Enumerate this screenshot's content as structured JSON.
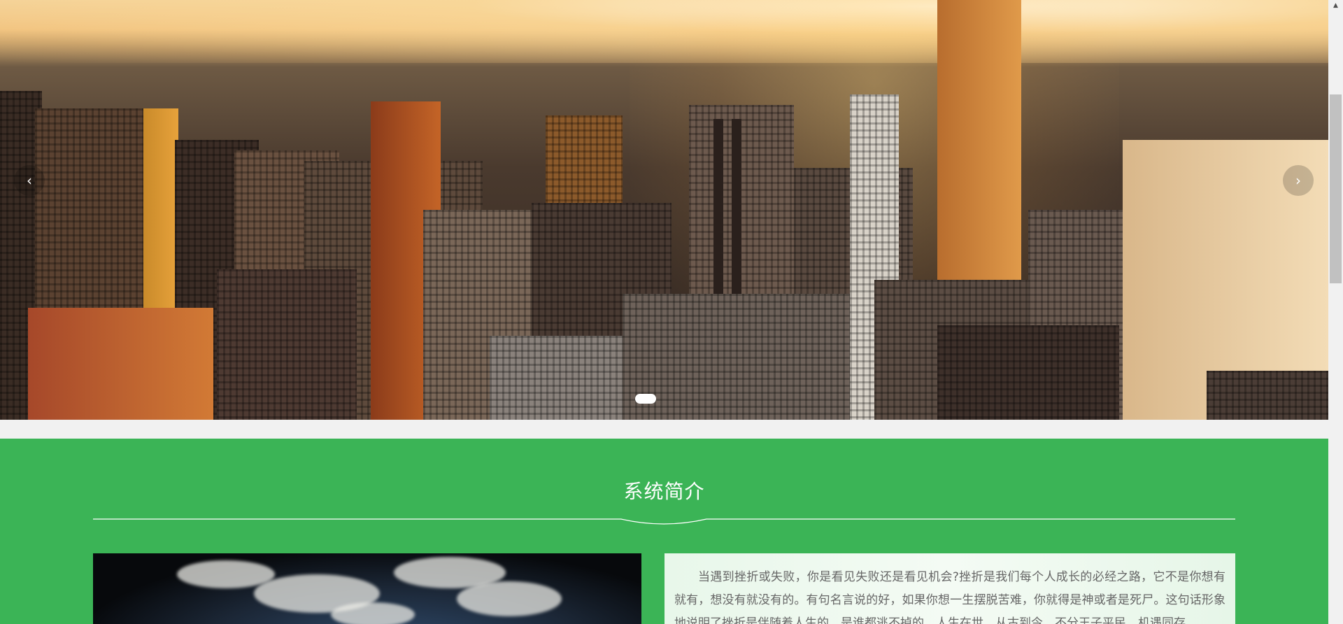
{
  "carousel": {
    "prev_icon": "‹",
    "next_icon": "›",
    "slide_count": 1,
    "active_index": 0
  },
  "intro": {
    "title": "系统简介",
    "paragraph": "当遇到挫折或失败，你是看见失败还是看见机会?挫折是我们每个人成长的必经之路，它不是你想有就有，想没有就没有的。有句名言说的好，如果你想一生摆脱苦难，你就得是神或者是死尸。这句话形象地说明了挫折是伴随着人生的，是谁都逃不掉的。人生在世，从古到今，不分王子平民，机遇同存。"
  },
  "colors": {
    "section_green": "#3bb456",
    "text_gray": "#666666"
  },
  "icons": {
    "prev": "chevron-left-icon",
    "next": "chevron-right-icon",
    "scroll_up": "scroll-up-arrow-icon"
  }
}
